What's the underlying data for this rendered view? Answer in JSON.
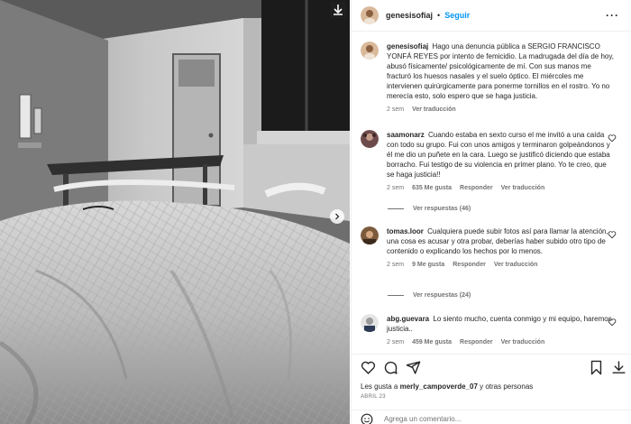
{
  "header": {
    "username": "genesisofiaj",
    "separator": "•",
    "follow_label": "Seguir",
    "more_label": "···"
  },
  "caption": {
    "username": "genesisofiaj",
    "text": "Hago una denuncia pública a SERGIO FRANCISCO YONFÁ REYES por intento de femicidio. La madrugada del día de hoy, abusó físicamente/ psicológicamente de mí. Con sus manos me fracturó los huesos nasales y el suelo óptico. El miércoles me intervienen quirúrgicamente para ponerme tornillos en el rostro. Yo no merecía esto, solo espero que se haga justicia.",
    "time": "2 sem",
    "translate": "Ver traducción"
  },
  "comments": [
    {
      "username": "saamonarz",
      "text": "Cuando estaba en sexto curso el me invitó a una caída con todo su grupo. Fui con unos amigos y terminaron golpeándonos y él me dio un puñete en la cara. Luego se justificó diciendo que estaba borracho. Fui testigo de su violencia en primer plano. Yo te creo, que se haga justicia!!",
      "time": "2 sem",
      "likes": "635 Me gusta",
      "reply": "Responder",
      "translate": "Ver traducción",
      "replies": "Ver respuestas (46)"
    },
    {
      "username": "tomas.loor",
      "text": "Cualquiera puede subir fotos así para llamar la atención, una cosa es acusar y otra probar, deberías haber subido otro tipo de contenido o explicando los hechos por lo menos.",
      "time": "2 sem",
      "likes": "9 Me gusta",
      "reply": "Responder",
      "translate": "Ver traducción",
      "replies": "Ver respuestas (24)"
    },
    {
      "username": "abg.guevara",
      "text": "Lo siento mucho, cuenta conmigo y mi equipo, haremos justicia..",
      "time": "2 sem",
      "likes": "459 Me gusta",
      "reply": "Responder",
      "translate": "Ver traducción"
    }
  ],
  "footer": {
    "likes_prefix": "Les gusta a",
    "likes_user": "merly_campoverde_07",
    "likes_suffix": "y otras personas",
    "date": "ABRIL 23",
    "comment_placeholder": "Agrega un comentario..."
  },
  "icons": {
    "heart": "heart-icon",
    "comment": "comment-icon",
    "share": "share-icon",
    "bookmark": "bookmark-icon",
    "download": "download-icon",
    "emoji": "emoji-icon"
  },
  "colors": {
    "accent": "#0095f6",
    "text": "#262626",
    "muted": "#737373",
    "divider": "#efefef"
  }
}
